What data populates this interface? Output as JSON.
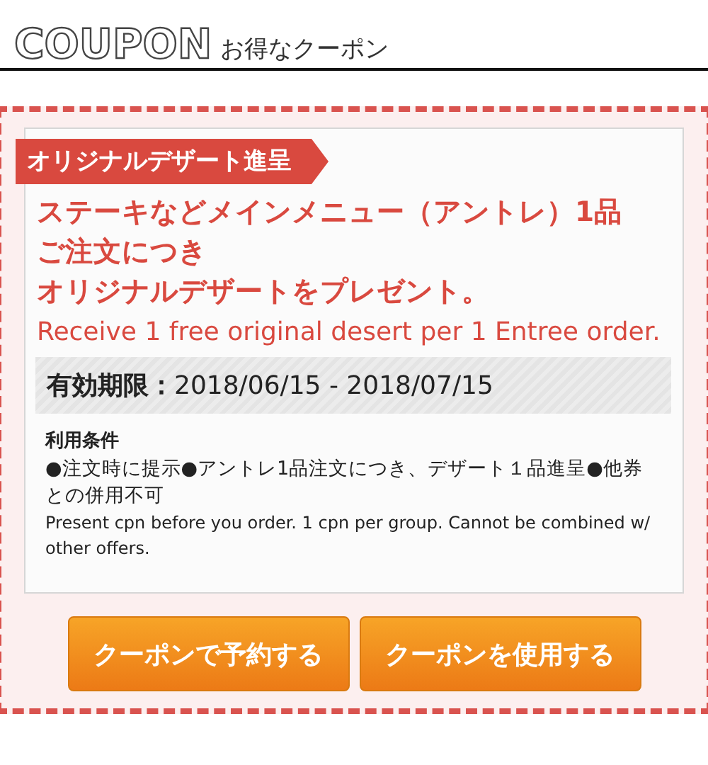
{
  "header": {
    "logo": "COUPON",
    "subtitle": "お得なクーポン"
  },
  "coupon": {
    "ribbon": "オリジナルデザート進呈",
    "title_lines": [
      "ステーキなどメインメニュー（アントレ）1品",
      "ご注文につき",
      "オリジナルデザートをプレゼント。"
    ],
    "title_en": "Receive 1 free original desert per 1 Entree order.",
    "validity": {
      "label": "有効期限：",
      "value": "2018/06/15 - 2018/07/15"
    },
    "conditions": {
      "heading": "利用条件",
      "text_ja": "●注文時に提示●アントレ1品注文につき、デザート１品進呈●他券との併用不可",
      "text_en": "Present cpn before you order. 1 cpn per group. Cannot be combined w/ other offers."
    }
  },
  "buttons": [
    "クーポンで予約する",
    "クーポンを使用する"
  ]
}
